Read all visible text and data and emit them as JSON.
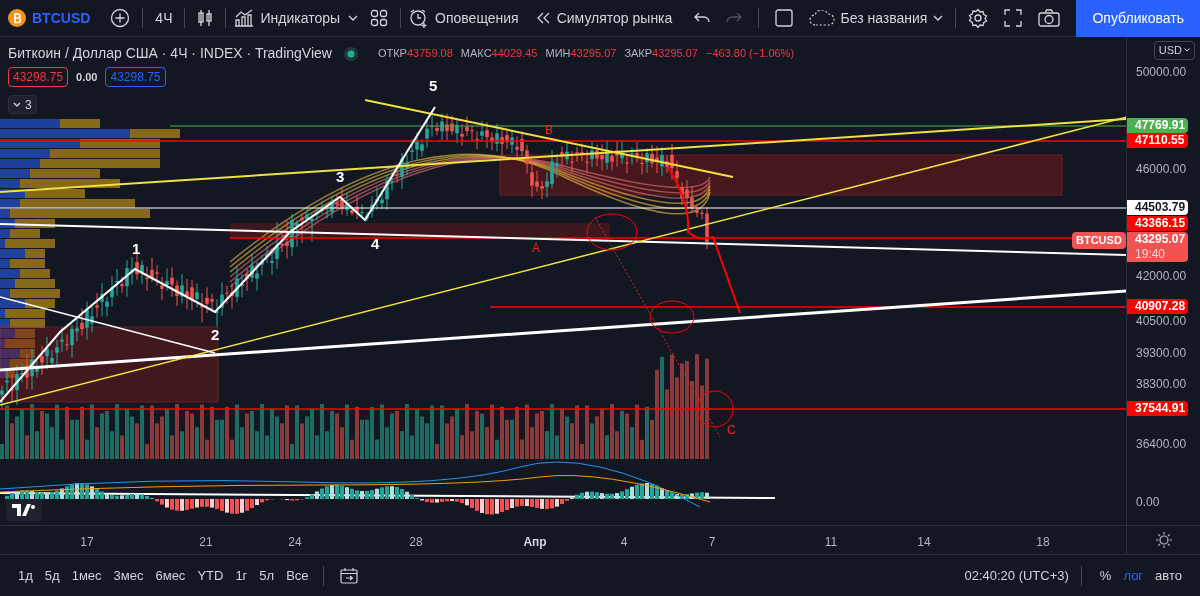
{
  "toolbar": {
    "symbol": "BTCUSD",
    "interval": "4Ч",
    "indicators": "Индикаторы",
    "alerts": "Оповещения",
    "replay": "Симулятор рынка",
    "layout_name": "Без названия",
    "publish": "Опубликовать"
  },
  "legend": {
    "title": "Биткоин / Доллар США · 4Ч · INDEX · TradingView",
    "market_open": true,
    "values": [
      {
        "label": "ОТКР",
        "value": "43759.08"
      },
      {
        "label": "МАКС",
        "value": "44029.45"
      },
      {
        "label": "МИН",
        "value": "43295.07"
      },
      {
        "label": "ЗАКР",
        "value": "43295.07"
      }
    ],
    "change": "−463.80 (−1.06%)",
    "bid": "43298.75",
    "spread": "0.00",
    "ask": "43298.75",
    "collapsed_count": "3"
  },
  "chart": {
    "annotations": [
      {
        "text": "1",
        "kind": "wave"
      },
      {
        "text": "2",
        "kind": "wave"
      },
      {
        "text": "3",
        "kind": "wave"
      },
      {
        "text": "4",
        "kind": "wave"
      },
      {
        "text": "5",
        "kind": "wave"
      },
      {
        "text": "B",
        "kind": "correction"
      },
      {
        "text": "A",
        "kind": "correction"
      },
      {
        "text": "C",
        "kind": "correction"
      }
    ]
  },
  "price_axis": {
    "currency": "USD",
    "ticks": [
      "50000.00",
      "46000.00",
      "42000.00",
      "40500.00",
      "39300.00",
      "38300.00",
      "36400.00"
    ],
    "markers": [
      {
        "value": "47769.91",
        "color": "#4caf50"
      },
      {
        "value": "47110.55",
        "color": "#ff0000"
      },
      {
        "value": "44503.79",
        "color": "#ffffff"
      },
      {
        "value": "43366.15",
        "color": "#ff0000"
      },
      {
        "value": "40907.28",
        "color": "#ff0000"
      },
      {
        "value": "37544.91",
        "color": "#ff0000"
      }
    ],
    "last_price": {
      "symbol": "BTCUSD",
      "value": "43295.07",
      "countdown": "19:40"
    },
    "oscillator_tick": "0.00"
  },
  "time_axis": [
    "17",
    "21",
    "24",
    "28",
    "Апр",
    "4",
    "7",
    "11",
    "14",
    "18"
  ],
  "bottom_bar": {
    "ranges": [
      "1д",
      "5д",
      "1мес",
      "3мес",
      "6мес",
      "YTD",
      "1г",
      "5л",
      "Все"
    ],
    "clock": "02:40:20 (UTC+3)",
    "scale_modes": [
      {
        "label": "%",
        "selected": false
      },
      {
        "label": "лог",
        "selected": true
      },
      {
        "label": "авто",
        "selected": false
      }
    ]
  }
}
